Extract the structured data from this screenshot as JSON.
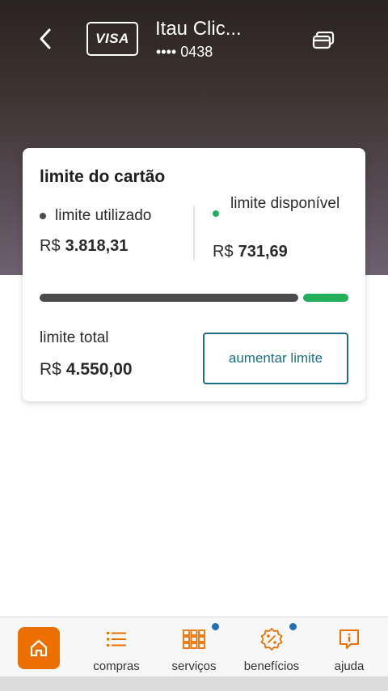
{
  "header": {
    "card_brand": "VISA",
    "card_name": "Itau Clic...",
    "card_number": "•••• 0438"
  },
  "limit_card": {
    "title": "limite do cartão",
    "used": {
      "label": "limite utilizado",
      "currency": "R$",
      "value": "3.818,31"
    },
    "available": {
      "label": "limite disponível",
      "currency": "R$",
      "value": "731,69"
    },
    "total": {
      "label": "limite total",
      "currency": "R$",
      "value": "4.550,00"
    },
    "usage_fraction": 0.839,
    "increase_button": "aumentar limite"
  },
  "bottom_nav": {
    "items": [
      {
        "label": "",
        "icon": "home-icon",
        "active": true
      },
      {
        "label": "compras",
        "icon": "list-icon"
      },
      {
        "label": "serviços",
        "icon": "grid-icon",
        "badge": true
      },
      {
        "label": "benefícios",
        "icon": "percent-badge-icon",
        "badge": true
      },
      {
        "label": "ajuda",
        "icon": "help-icon"
      }
    ]
  },
  "colors": {
    "accent_orange": "#ec7000",
    "teal": "#1a6f85",
    "available_green": "#22b05b",
    "used_gray": "#4b4b4b",
    "badge_blue": "#1f6fb2"
  }
}
